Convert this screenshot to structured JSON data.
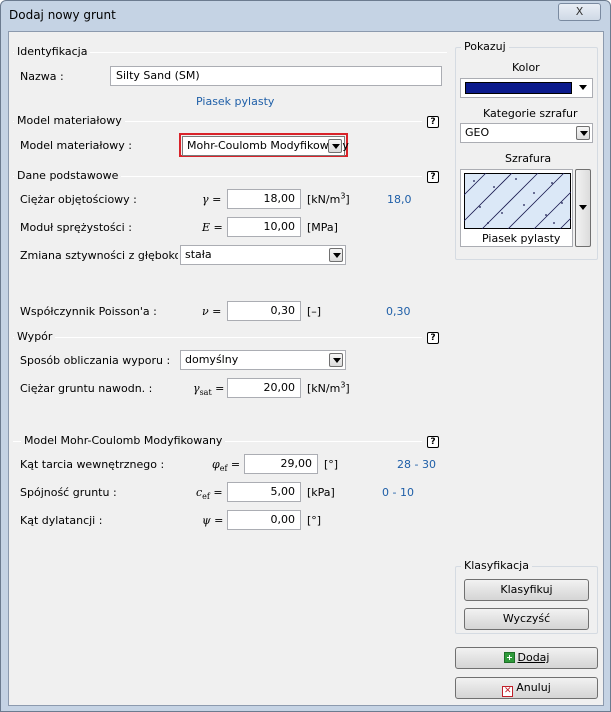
{
  "window": {
    "title": "Dodaj nowy grunt",
    "close_label": "X"
  },
  "identification": {
    "group": "Identyfikacja",
    "name_label": "Nazwa :",
    "name_value": "Silty Sand (SM)",
    "name_hint": "Piasek pylasty"
  },
  "material_model": {
    "group": "Model materiałowy",
    "label": "Model materiałowy :",
    "value": "Mohr-Coulomb Modyfikowany"
  },
  "basic": {
    "group": "Dane podstawowe",
    "unit_weight": {
      "label": "Ciężar objętościowy :",
      "symbol": "γ =",
      "value": "18,00",
      "unit": "[kN/m",
      "unit_sup": "3",
      "unit_end": "]",
      "hint": "18,0"
    },
    "modulus": {
      "label": "Moduł sprężystości :",
      "symbol": "E =",
      "value": "10,00",
      "unit": "[MPa]"
    },
    "stiffness": {
      "label": "Zmiana sztywności z głębokością",
      "value": "stała"
    },
    "poisson": {
      "label": "Współczynnik Poisson'a :",
      "symbol": "ν =",
      "value": "0,30",
      "unit": "[–]",
      "hint": "0,30"
    }
  },
  "uplift": {
    "group": "Wypór",
    "method_label": "Sposób obliczania wyporu :",
    "method_value": "domyślny",
    "sat_label": "Ciężar gruntu nawodn. :",
    "sat_symbol": "γ",
    "sat_sub": "sat",
    "sat_eq": "=",
    "sat_value": "20,00",
    "sat_unit": "[kN/m",
    "sat_unit_sup": "3",
    "sat_unit_end": "]"
  },
  "mohr": {
    "group": "Model Mohr-Coulomb Modyfikowany",
    "friction": {
      "label": "Kąt tarcia wewnętrznego :",
      "symbol": "φ",
      "sub": "ef",
      "eq": "=",
      "value": "29,00",
      "unit": "[°]",
      "hint": "28 - 30"
    },
    "cohesion": {
      "label": "Spójność gruntu :",
      "symbol": "c",
      "sub": "ef",
      "eq": "=",
      "value": "5,00",
      "unit": "[kPa]",
      "hint": "0 - 10"
    },
    "dilation": {
      "label": "Kąt dylatancji :",
      "symbol": "ψ =",
      "value": "0,00",
      "unit": "[°]"
    }
  },
  "show": {
    "group": "Pokazuj",
    "color_label": "Kolor",
    "color_value": "#0b1a8c",
    "hatch_category_label": "Kategorie szrafur",
    "hatch_category_value": "GEO",
    "hatch_label": "Szrafura",
    "hatch_name": "Piasek pylasty"
  },
  "classification": {
    "group": "Klasyfikacja",
    "classify_label": "Klasyfikuj",
    "clear_label": "Wyczyść"
  },
  "actions": {
    "add_label": "Dodaj",
    "cancel_label": "Anuluj"
  },
  "help_glyph": "?"
}
